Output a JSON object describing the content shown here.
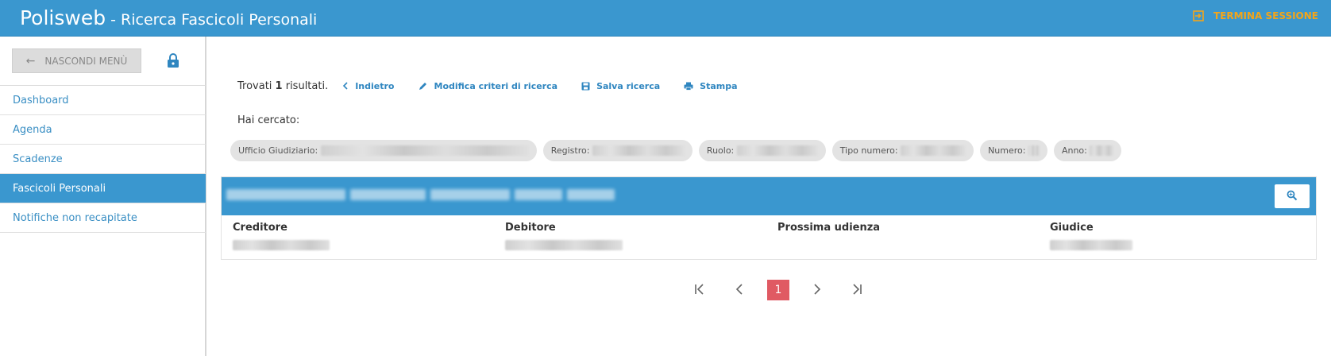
{
  "header": {
    "app_name": "Polisweb",
    "subtitle": " - Ricerca Fascicoli Personali",
    "logout_label": "TERMINA SESSIONE"
  },
  "sidebar": {
    "hide_menu_label": "NASCONDI MENÙ",
    "items": [
      {
        "label": "Dashboard",
        "active": false
      },
      {
        "label": "Agenda",
        "active": false
      },
      {
        "label": "Scadenze",
        "active": false
      },
      {
        "label": "Fascicoli Personali",
        "active": true
      },
      {
        "label": "Notifiche non recapitate",
        "active": false
      }
    ]
  },
  "results": {
    "prefix": "Trovati ",
    "count": "1",
    "suffix": " risultati.",
    "back_label": "Indietro",
    "modify_label": "Modifica criteri di ricerca",
    "save_label": "Salva ricerca",
    "print_label": "Stampa",
    "searched_label": "Hai cercato:"
  },
  "filters": [
    {
      "label": "Ufficio Giudiziario:"
    },
    {
      "label": "Registro:"
    },
    {
      "label": "Ruolo:"
    },
    {
      "label": "Tipo numero:"
    },
    {
      "label": "Numero:"
    },
    {
      "label": "Anno:"
    }
  ],
  "table": {
    "columns": [
      "Creditore",
      "Debitore",
      "Prossima udienza",
      "Giudice"
    ]
  },
  "pagination": {
    "first": "|<",
    "prev": "<",
    "current": "1",
    "next": ">",
    "last": ">|"
  },
  "colors": {
    "primary": "#3a97cf",
    "accent": "#f2a51a",
    "page_active": "#e05a63"
  }
}
